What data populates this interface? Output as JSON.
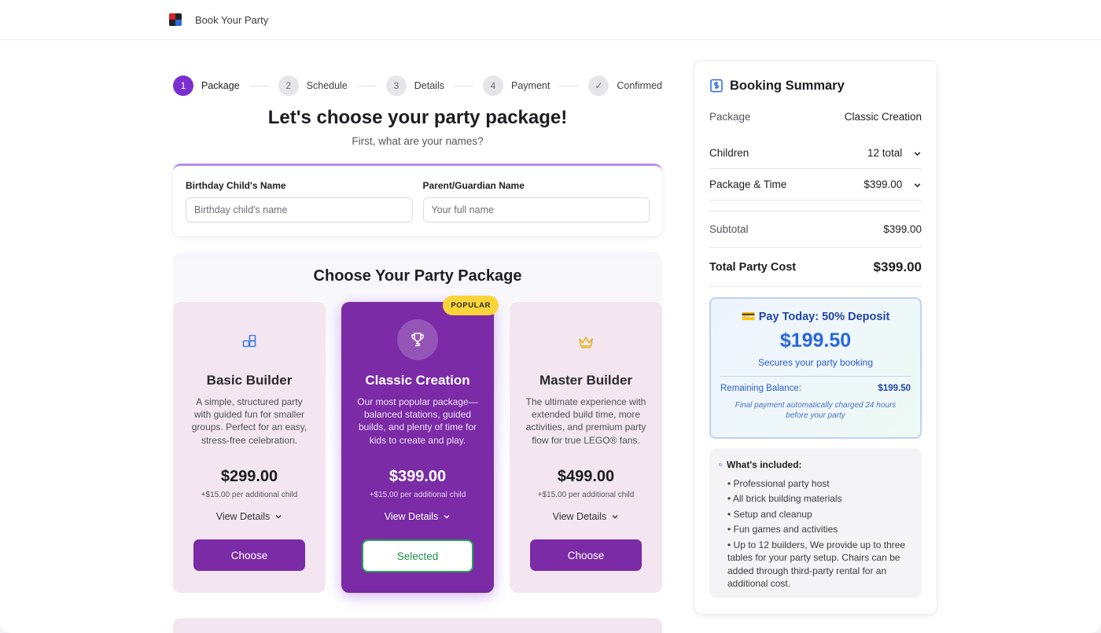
{
  "header": {
    "brand": "Book Your Party"
  },
  "stepper": [
    {
      "number": "1",
      "label": "Package"
    },
    {
      "number": "2",
      "label": "Schedule"
    },
    {
      "number": "3",
      "label": "Details"
    },
    {
      "number": "4",
      "label": "Payment"
    },
    {
      "number": "✓",
      "label": "Confirmed"
    }
  ],
  "intro": {
    "title": "Let's choose your party package!",
    "subtitle": "First, what are your names?"
  },
  "names": {
    "child_label": "Birthday Child's Name",
    "child_placeholder": "Birthday child's name",
    "child_value": "",
    "parent_label": "Parent/Guardian Name",
    "parent_placeholder": "Your full name",
    "parent_value": ""
  },
  "packages": {
    "heading": "Choose Your Party Package",
    "badge": "POPULAR",
    "items": [
      {
        "icon": "blocks-icon",
        "name": "Basic Builder",
        "description": "A simple, structured party with guided fun for smaller groups. Perfect for an easy, stress-free celebration.",
        "price": "$299.00",
        "extra": "+$15.00 per additional child",
        "details_label": "View Details",
        "button_label": "Choose"
      },
      {
        "icon": "trophy-icon",
        "name": "Classic Creation",
        "description": "Our most popular package—balanced stations, guided builds, and plenty of time for kids to create and play.",
        "price": "$399.00",
        "extra": "+$15.00 per additional child",
        "details_label": "View Details",
        "button_label": "Selected"
      },
      {
        "icon": "crown-icon",
        "name": "Master Builder",
        "description": "The ultimate experience with extended build time, more activities, and premium party flow for true LEGO® fans.",
        "price": "$499.00",
        "extra": "+$15.00 per additional child",
        "details_label": "View Details",
        "button_label": "Choose"
      }
    ]
  },
  "summary": {
    "title": "Booking Summary",
    "package_label": "Package",
    "package_value": "Classic Creation",
    "children_label": "Children",
    "children_value": "12 total",
    "time_label": "Package & Time",
    "time_value": "$399.00",
    "subtotal_label": "Subtotal",
    "subtotal_value": "$399.00",
    "total_label": "Total Party Cost",
    "total_value": "$399.00",
    "deposit": {
      "icon": "💳",
      "title": "Pay Today: 50% Deposit",
      "amount": "$199.50",
      "subtitle": "Secures your party booking",
      "remaining_label": "Remaining Balance:",
      "remaining_value": "$199.50",
      "note": "Final payment automatically charged 24 hours before your party"
    },
    "included": {
      "heading": "What's included:",
      "items": [
        "• Professional party host",
        "• All brick building materials",
        "• Setup and cleanup",
        "• Fun games and activities",
        "• Up to 12 builders, We provide up to three tables for your party setup. Chairs can be added through third-party rental for an additional cost."
      ]
    }
  },
  "colors": {
    "accent": "#7c2fd0",
    "card_purple": "#7a2ba5",
    "card_light": "#f3e6f1",
    "badge_yellow": "#fbd43a",
    "selected_green": "#26a35a",
    "deposit_blue": "#2a67df"
  }
}
